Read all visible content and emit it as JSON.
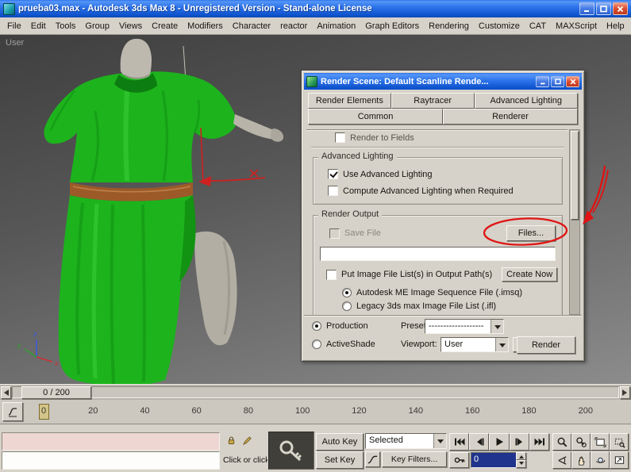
{
  "window": {
    "title": "prueba03.max - Autodesk 3ds Max 8  - Unregistered Version - Stand-alone License",
    "menu_items": [
      "File",
      "Edit",
      "Tools",
      "Group",
      "Views",
      "Create",
      "Modifiers",
      "Character",
      "reactor",
      "Animation",
      "Graph Editors",
      "Rendering",
      "Customize",
      "CAT",
      "MAXScript",
      "Help"
    ]
  },
  "viewport": {
    "label": "User",
    "axis_x": "x",
    "axis_y": "y",
    "axis_z": "z"
  },
  "render_dialog": {
    "title": "Render Scene: Default Scanline Rende...",
    "tabs_row1": [
      "Render Elements",
      "Raytracer",
      "Advanced Lighting"
    ],
    "tabs_row2": [
      "Common",
      "Renderer"
    ],
    "clipped_row": "Render to Fields",
    "advanced_lighting": {
      "title": "Advanced Lighting",
      "use_advanced_lighting": "Use Advanced Lighting",
      "compute_when_required": "Compute Advanced Lighting when Required"
    },
    "render_output": {
      "title": "Render Output",
      "save_file": "Save File",
      "files_button": "Files...",
      "output_path": "",
      "put_image_list": "Put Image File List(s) in Output Path(s)",
      "create_now_button": "Create Now",
      "autodesk_me": "Autodesk ME Image Sequence File (.imsq)",
      "legacy_ifl": "Legacy 3ds max Image File List (.ifl)"
    },
    "footer": {
      "production": "Production",
      "preset_label": "Preset:",
      "preset_value": "-------------------",
      "activeshade": "ActiveShade",
      "viewport_label": "Viewport:",
      "viewport_value": "User",
      "render_button": "Render"
    }
  },
  "timeline": {
    "slider_label": "0 / 200",
    "ticks": [
      "0",
      "20",
      "40",
      "60",
      "80",
      "100",
      "120",
      "140",
      "160",
      "180",
      "200"
    ]
  },
  "status": {
    "prompt": "Click or click",
    "auto_key": "Auto Key",
    "set_key": "Set Key",
    "selected_dropdown": "Selected",
    "key_filters": "Key Filters...",
    "frame_field": "0"
  },
  "colors": {
    "annotation_red": "#e01414",
    "tunic_green": "#1db31d",
    "belt_brown": "#9c5a28",
    "titlebar_blue": "#2e74ea"
  }
}
